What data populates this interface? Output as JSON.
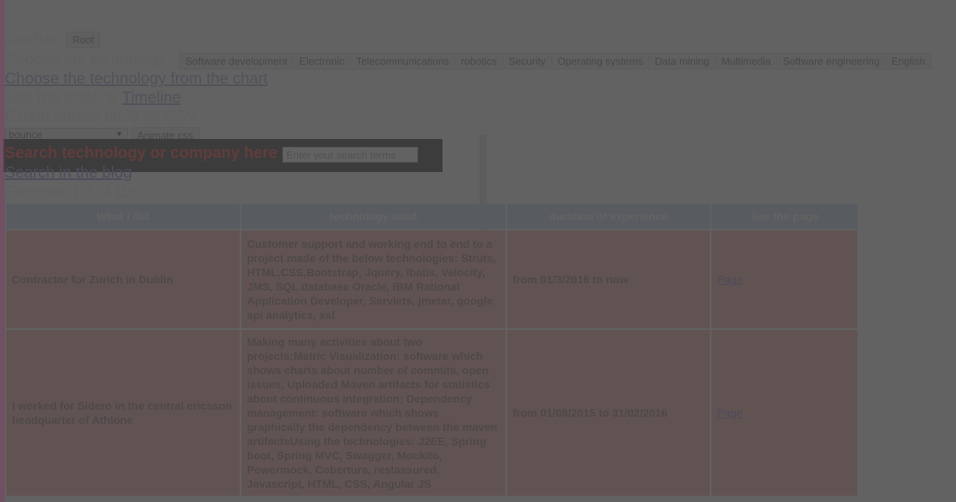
{
  "navbar": {
    "label": "NavBar:",
    "root_button": "Root"
  },
  "technology": {
    "label": "Choose the technology",
    "buttons": [
      "Software development",
      "Electronic",
      "Telecommunications",
      "robotics",
      "Security",
      "Operating systems",
      "Data mining",
      "Multimedia",
      "Software engineering",
      "English"
    ],
    "chart_link": "Choose the technology from the chart"
  },
  "timeline": {
    "prefix": "See the timeline",
    "link": "Timeline"
  },
  "export": {
    "label": "Export shown table as CSV"
  },
  "animation": {
    "selected": "bounce",
    "button": "Animate css"
  },
  "search": {
    "label": "Search technology or company here",
    "placeholder": "Enter your search terms",
    "blog_link": "Search in the blog"
  },
  "elements_count": "Elements: 118 of 118",
  "table": {
    "headers": [
      "What I did",
      "technology used",
      "duration of experience",
      "See the page"
    ],
    "rows": [
      {
        "what": "Contractor for Zurich in Dublin",
        "technology": "Customer support and working end to end to a project made of the below technologies: Struts, HTML,CSS,Bootstrap, Jquery, Ibatis, Velocity, JMS, SQL database Oracle, IBM Rational Application Developer, Servlets, jmeter, google api analytics, xsl",
        "duration": "from 01/3/2016 to now",
        "page": "Page"
      },
      {
        "what": "I worked for Sidero in the central ericsson headquarter of Athlone",
        "technology": "Making many activities about two projects:Metric Visualization: software which shows charts about number of commits, open issues, Uploaded Maven artifacts for statistics about continuous integration; Dependency management: software which shows graphically the dependency between the maven artifactsUsing the technologies: J2EE, Spring boot, Spring MVC, Swagger, Mockito, Powermock, Cobertura, restassured, Javascript, HTML, CSS, Angular JS",
        "duration": "from 01/08/2015 to 31/02/2016",
        "page": "Page"
      }
    ]
  }
}
